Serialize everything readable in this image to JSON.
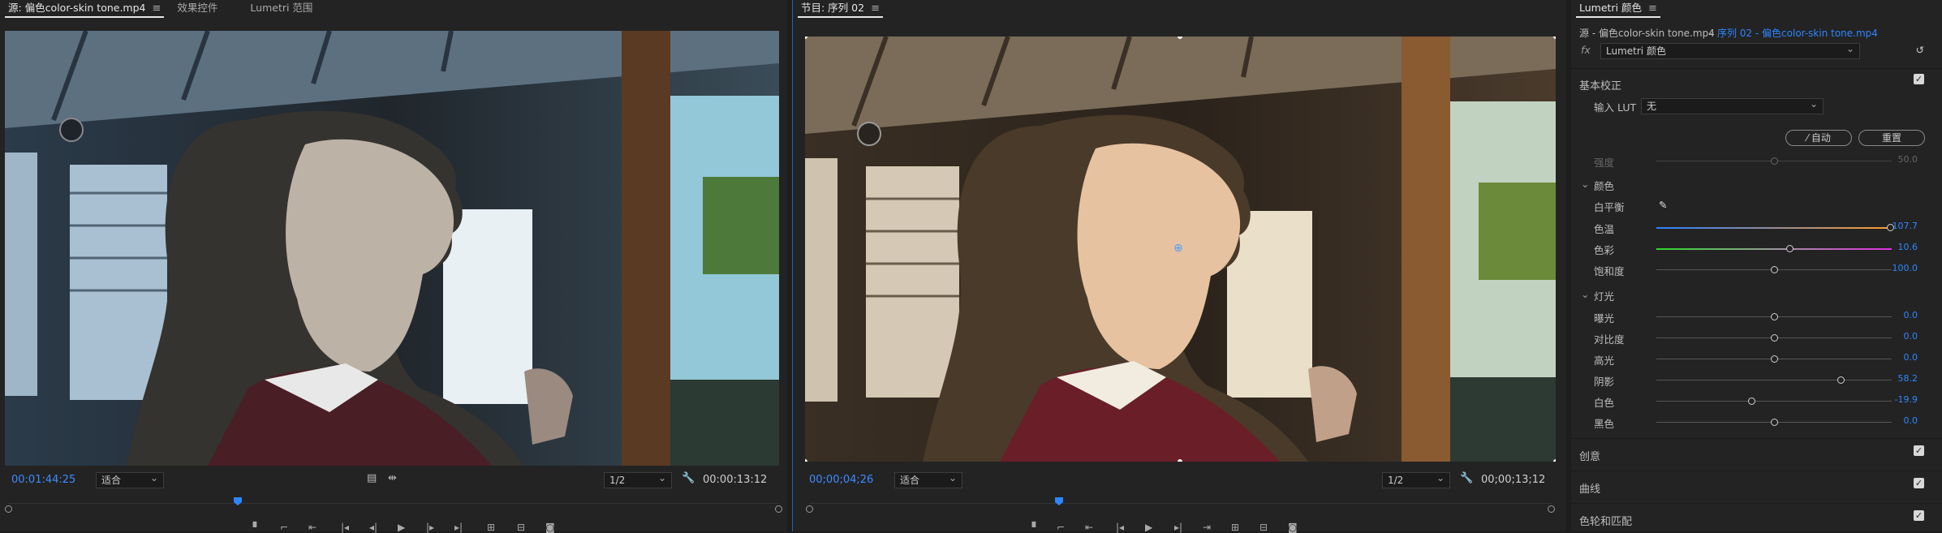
{
  "source_panel": {
    "tabs": [
      "源: 偏色color-skin tone.mp4",
      "效果控件",
      "Lumetri 范围"
    ],
    "timecode_in": "00:01:44:25",
    "fit": "适合",
    "quality": "1/2",
    "timecode_dur": "00:00:13:12"
  },
  "program_panel": {
    "title": "节目: 序列 02",
    "timecode_in": "00;00;04;26",
    "fit": "适合",
    "quality": "1/2",
    "timecode_dur": "00;00;13;12"
  },
  "lumetri": {
    "title": "Lumetri 颜色",
    "source_label": "源 - 偏色color-skin tone.mp4",
    "seq_label": "序列 02 - 偏色color-skin tone.mp4",
    "fx_label": "fx",
    "effect_name": "Lumetri 颜色",
    "basic": {
      "title": "基本校正",
      "input_lut_label": "输入 LUT",
      "input_lut_value": "无",
      "auto_button": "自动",
      "reset_button": "重置",
      "strength_label": "强度",
      "strength_value": "50.0"
    },
    "color_section": {
      "title": "颜色",
      "wb_label": "白平衡",
      "temp_label": "色温",
      "temp_value": "107.7",
      "tint_label": "色彩",
      "tint_value": "10.6",
      "sat_label": "饱和度",
      "sat_value": "100.0"
    },
    "light_section": {
      "title": "灯光",
      "rows": [
        {
          "label": "曝光",
          "value": "0.0",
          "pos": 0.5
        },
        {
          "label": "对比度",
          "value": "0.0",
          "pos": 0.5
        },
        {
          "label": "高光",
          "value": "0.0",
          "pos": 0.5
        },
        {
          "label": "阴影",
          "value": "58.2",
          "pos": 0.79
        },
        {
          "label": "白色",
          "value": "-19.9",
          "pos": 0.4
        },
        {
          "label": "黑色",
          "value": "0.0",
          "pos": 0.5
        }
      ]
    },
    "sections": [
      "创意",
      "曲线",
      "色轮和匹配"
    ]
  },
  "colors": {
    "accent": "#2e86ff",
    "panel_bg": "#232323"
  }
}
